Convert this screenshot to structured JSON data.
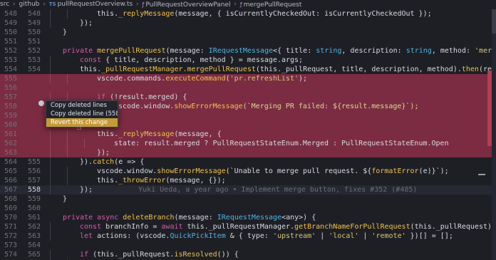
{
  "breadcrumbs": {
    "items": [
      {
        "name": "breadcrumb-src",
        "label": "src"
      },
      {
        "name": "breadcrumb-github",
        "label": "github"
      },
      {
        "name": "breadcrumb-file",
        "label": "pullRequestOverview.ts",
        "icon": "ts-icon",
        "icon_text": "TS"
      },
      {
        "name": "breadcrumb-class",
        "label": "PullRequestOverviewPanel",
        "icon": "class-icon",
        "icon_text": "ƒ"
      },
      {
        "name": "breadcrumb-method",
        "label": "mergePullRequest",
        "icon": "method-icon",
        "icon_text": "ƒ"
      }
    ],
    "separator": "›"
  },
  "editor": {
    "lines": [
      {
        "old": "548",
        "new": "548",
        "indent": 3,
        "segments": [
          {
            "t": "this."
          },
          {
            "t": "_replyMessage",
            "c": "t-fn"
          },
          {
            "t": "(message, { isCurrentlyCheckedOut: isCurrentlyCheckedOut });"
          }
        ]
      },
      {
        "old": "549",
        "new": "549",
        "indent": 2,
        "segments": [
          {
            "t": "});"
          }
        ]
      },
      {
        "old": "550",
        "new": "550",
        "indent": 1,
        "segments": [
          {
            "t": "}"
          }
        ]
      },
      {
        "old": "551",
        "new": "551",
        "indent": 0,
        "segments": []
      },
      {
        "old": "552",
        "new": "552",
        "indent": 1,
        "segments": [
          {
            "t": "private ",
            "c": "t-kw"
          },
          {
            "t": "mergePullRequest",
            "c": "t-fn"
          },
          {
            "t": "(message: "
          },
          {
            "t": "IRequestMessage",
            "c": "t-type"
          },
          {
            "t": "<{ title: "
          },
          {
            "t": "string",
            "c": "t-type"
          },
          {
            "t": ", description: "
          },
          {
            "t": "string",
            "c": "t-type"
          },
          {
            "t": ", method: "
          },
          {
            "t": "'merge'",
            "c": "t-str"
          },
          {
            "t": " | "
          },
          {
            "t": "'s",
            "c": "t-str"
          }
        ]
      },
      {
        "old": "553",
        "new": "553",
        "indent": 2,
        "segments": [
          {
            "t": "const ",
            "c": "t-kw"
          },
          {
            "t": "{ title, description, method } = message.args;"
          }
        ]
      },
      {
        "old": "554",
        "new": "554",
        "indent": 2,
        "segments": [
          {
            "t": "this."
          },
          {
            "t": "_pullRequestManager.",
            "c": "t-fn"
          },
          {
            "t": "mergePullRequest",
            "c": "t-fn"
          },
          {
            "t": "(this._pullRequest, title, description, method)."
          },
          {
            "t": "then",
            "c": "t-fn"
          },
          {
            "t": "(result => {"
          }
        ]
      },
      {
        "old": "555",
        "new": "",
        "indent": 3,
        "deleted": true,
        "segments": [
          {
            "t": "vscode.commands."
          },
          {
            "t": "executeCommand",
            "c": "t-fn"
          },
          {
            "t": "("
          },
          {
            "t": "'pr.refreshList'",
            "c": "t-str"
          },
          {
            "t": ");"
          }
        ]
      },
      {
        "old": "556",
        "new": "",
        "indent": 0,
        "deleted": true,
        "segments": []
      },
      {
        "old": "557",
        "new": "",
        "indent": 3,
        "deleted": true,
        "segments": [
          {
            "t": "if ",
            "c": "t-kw"
          },
          {
            "t": "(!result.merged) {"
          }
        ]
      },
      {
        "old": "558",
        "new": "",
        "indent": 4,
        "deleted": true,
        "segments": [
          {
            "t": "vscode.window."
          },
          {
            "t": "showErrorMessage",
            "c": "t-fn"
          },
          {
            "t": "(`Merging PR failed: ${result.message}`);",
            "c": "t-str2"
          }
        ]
      },
      {
        "old": "559",
        "new": "",
        "indent": 3,
        "deleted": true,
        "segments": [
          {
            "t": "}"
          }
        ]
      },
      {
        "old": "560",
        "new": "",
        "indent": 0,
        "deleted": true,
        "segments": []
      },
      {
        "old": "561",
        "new": "",
        "indent": 3,
        "deleted": true,
        "segments": [
          {
            "t": "this."
          },
          {
            "t": "_replyMessage",
            "c": "t-fn"
          },
          {
            "t": "(message, {"
          }
        ]
      },
      {
        "old": "562",
        "new": "",
        "indent": 4,
        "deleted": true,
        "segments": [
          {
            "t": "state: result.merged ? PullRequestStateEnum.Merged : PullRequestStateEnum.Open"
          }
        ]
      },
      {
        "old": "563",
        "new": "",
        "indent": 3,
        "deleted": true,
        "segments": [
          {
            "t": "});"
          }
        ]
      },
      {
        "old": "564",
        "new": "555",
        "indent": 2,
        "segments": [
          {
            "t": "})."
          },
          {
            "t": "catch",
            "c": "t-fn"
          },
          {
            "t": "(e => {"
          }
        ]
      },
      {
        "old": "565",
        "new": "556",
        "indent": 3,
        "segments": [
          {
            "t": "vscode.window."
          },
          {
            "t": "showErrorMessage",
            "c": "t-fn"
          },
          {
            "t": "(`Unable to merge pull request. ${"
          },
          {
            "t": "formatError",
            "c": "t-fn"
          },
          {
            "t": "(e)}`);"
          }
        ]
      },
      {
        "old": "566",
        "new": "557",
        "indent": 3,
        "segments": [
          {
            "t": "this."
          },
          {
            "t": "_throwError",
            "c": "t-fn"
          },
          {
            "t": "(message, {});"
          }
        ]
      },
      {
        "old": "567",
        "new": "558",
        "indent": 2,
        "current": true,
        "segments": [
          {
            "t": "});"
          }
        ],
        "blame": "Yuki Ueda, a year ago • Implement merge button, fixes #352 (#485)"
      },
      {
        "old": "568",
        "new": "559",
        "indent": 1,
        "segments": [
          {
            "t": "}"
          }
        ]
      },
      {
        "old": "569",
        "new": "560",
        "indent": 0,
        "segments": []
      },
      {
        "old": "570",
        "new": "561",
        "indent": 1,
        "segments": [
          {
            "t": "private async ",
            "c": "t-kw"
          },
          {
            "t": "deleteBranch",
            "c": "t-fn"
          },
          {
            "t": "(message: "
          },
          {
            "t": "IRequestMessage",
            "c": "t-type"
          },
          {
            "t": "<any>) {"
          }
        ]
      },
      {
        "old": "571",
        "new": "562",
        "indent": 2,
        "segments": [
          {
            "t": "const ",
            "c": "t-kw"
          },
          {
            "t": "branchInfo = "
          },
          {
            "t": "await ",
            "c": "t-kw"
          },
          {
            "t": "this._pullRequestManager."
          },
          {
            "t": "getBranchNameForPullRequest",
            "c": "t-fn"
          },
          {
            "t": "(this._pullRequest);"
          }
        ]
      },
      {
        "old": "572",
        "new": "563",
        "indent": 2,
        "segments": [
          {
            "t": "let ",
            "c": "t-kw"
          },
          {
            "t": "actions: (vscode."
          },
          {
            "t": "QuickPickItem",
            "c": "t-type"
          },
          {
            "t": " & { type: "
          },
          {
            "t": "'upstream'",
            "c": "t-str"
          },
          {
            "t": " | "
          },
          {
            "t": "'local'",
            "c": "t-str"
          },
          {
            "t": " | "
          },
          {
            "t": "'remote'",
            "c": "t-str"
          },
          {
            "t": " })[] = [];"
          }
        ]
      },
      {
        "old": "573",
        "new": "564",
        "indent": 0,
        "segments": []
      },
      {
        "old": "574",
        "new": "565",
        "indent": 2,
        "segments": [
          {
            "t": "if ",
            "c": "t-kw"
          },
          {
            "t": "(this._pullRequest."
          },
          {
            "t": "isResolved",
            "c": "t-fn"
          },
          {
            "t": "()) {"
          }
        ]
      },
      {
        "old": "575",
        "new": "566",
        "indent": 3,
        "segments": [
          {
            "t": "const ",
            "c": "t-kw"
          },
          {
            "t": "branchHeadRef = this._pullRequest.head.ref;"
          }
        ]
      }
    ]
  },
  "context_menu": {
    "items": [
      {
        "label": "Copy deleted lines",
        "name": "copy-deleted-lines-item"
      },
      {
        "label": "Copy deleted line (558)",
        "name": "copy-deleted-line-item"
      },
      {
        "label": "Revert this change",
        "name": "revert-change-item",
        "active": true
      }
    ]
  },
  "theme": {
    "deleted_background": "#7b2c42",
    "menu_active": "#c49a36",
    "cursor_icon": "pointer-cursor-icon"
  }
}
